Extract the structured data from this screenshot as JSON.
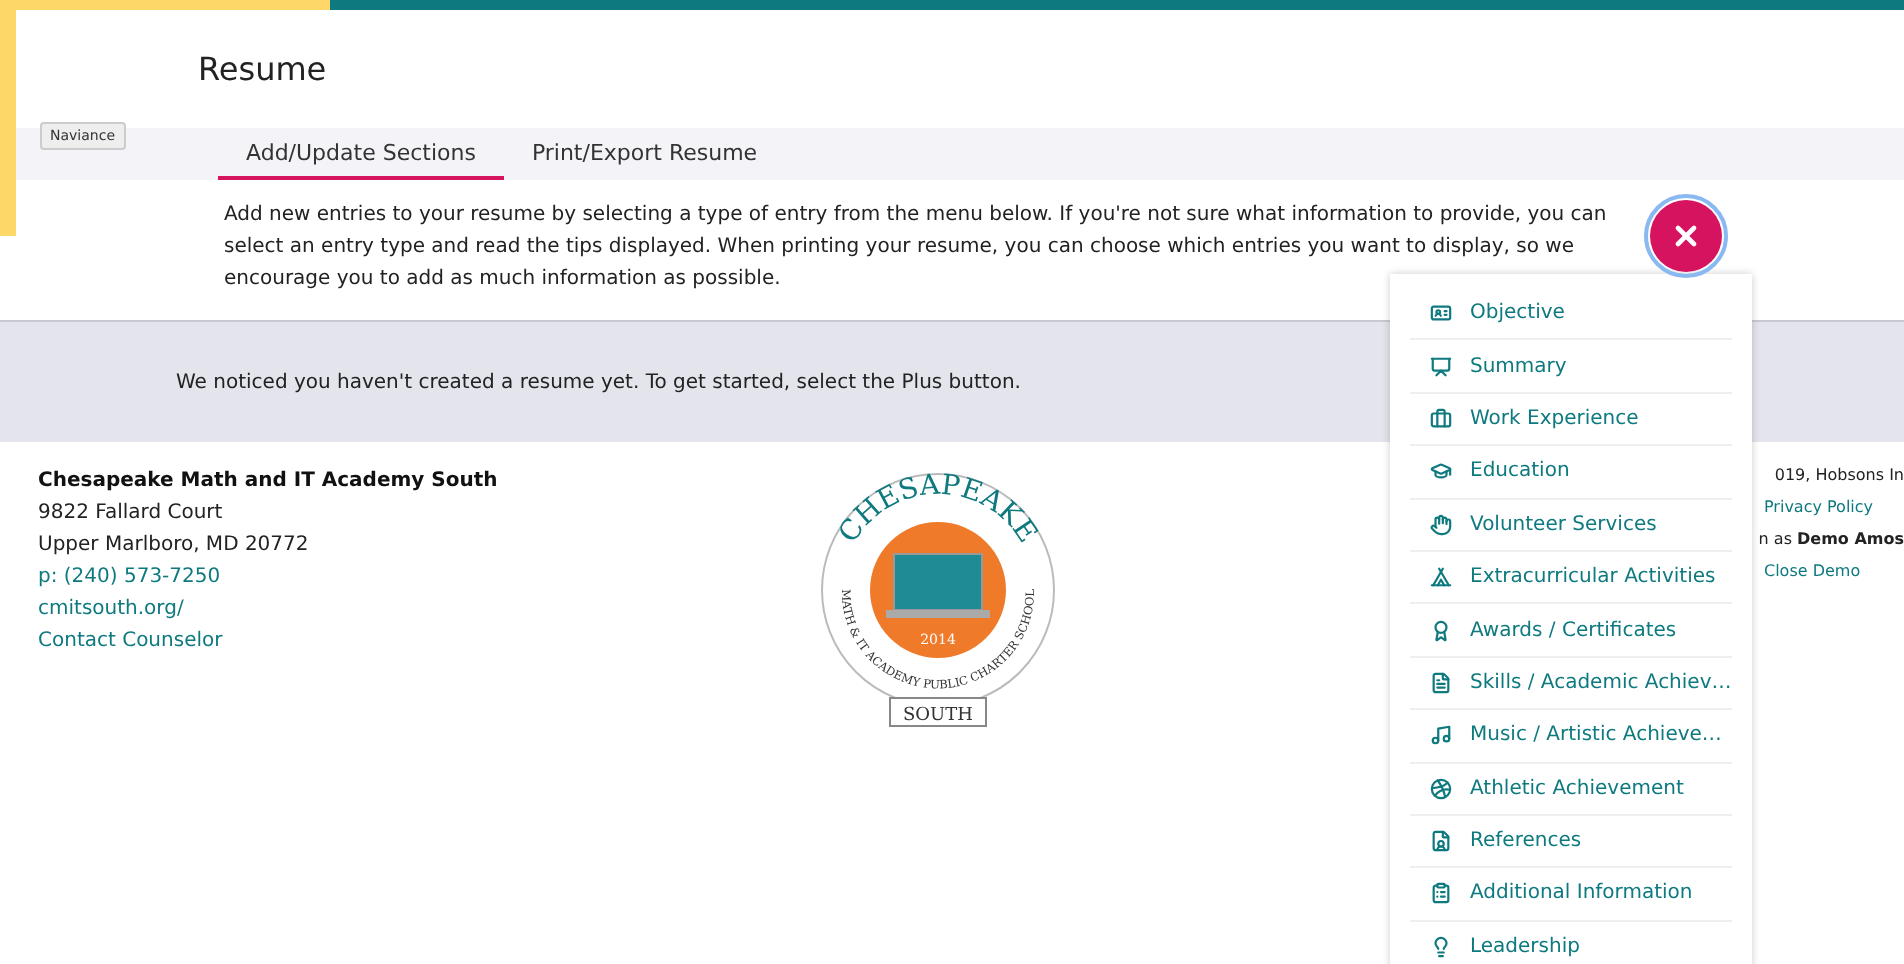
{
  "brand_badge": "Naviance",
  "page_title": "Resume",
  "tabs": [
    {
      "label": "Add/Update Sections",
      "selected": true
    },
    {
      "label": "Print/Export Resume",
      "selected": false
    }
  ],
  "intro": "Add new entries to your resume by selecting a type of entry from the menu below. If you're not sure what information to provide, you can select an entry type and read the tips displayed. When printing your resume, you can choose which entries you want to display, so we encourage you to add as much information as possible.",
  "notice": "We noticed you haven't created a resume yet. To get started, select the Plus button.",
  "footer": {
    "school": "Chesapeake Math and IT Academy South",
    "address_lines": [
      "9822 Fallard Court",
      "Upper Marlboro, MD 20772"
    ],
    "links": [
      "p: (240) 573-7250",
      "cmitsouth.org/",
      "Contact Counselor"
    ],
    "logo": {
      "top": "CHESAPEAKE",
      "ring": "MATH & IT ACADEMY PUBLIC CHARTER SCHOOL",
      "year": "2014",
      "banner": "SOUTH"
    },
    "right": [
      {
        "kind": "text",
        "text": "019, Hobsons In"
      },
      {
        "kind": "link",
        "text": "Privacy Policy"
      },
      {
        "kind": "text",
        "text": "n as **Demo Amos**"
      },
      {
        "kind": "link",
        "text": "Close Demo"
      }
    ]
  },
  "menu": {
    "open": true,
    "items": [
      "Objective",
      "Summary",
      "Work Experience",
      "Education",
      "Volunteer Services",
      "Extracurricular Activities",
      "Awards / Certificates",
      "Skills / Academic Achiev…",
      "Music / Artistic Achieve…",
      "Athletic Achievement",
      "References",
      "Additional Information",
      "Leadership"
    ]
  }
}
